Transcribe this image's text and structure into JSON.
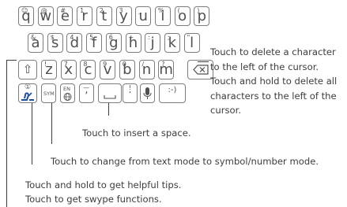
{
  "keyboard": {
    "row1": [
      {
        "main": "q",
        "alt": "☺"
      },
      {
        "main": "w",
        "alt": "@"
      },
      {
        "main": "e",
        "alt": "#"
      },
      {
        "main": "r",
        "alt": "1"
      },
      {
        "main": "t",
        "alt": "2"
      },
      {
        "main": "y",
        "alt": "3"
      },
      {
        "main": "u",
        "alt": "_"
      },
      {
        "main": "i",
        "alt": "%"
      },
      {
        "main": "o",
        "alt": "("
      },
      {
        "main": "p",
        "alt": ")"
      }
    ],
    "row2": [
      {
        "main": "a",
        "alt": "&"
      },
      {
        "main": "s",
        "alt": "$"
      },
      {
        "main": "d",
        "alt": "4"
      },
      {
        "main": "f",
        "alt": "5"
      },
      {
        "main": "g",
        "alt": "6"
      },
      {
        "main": "h",
        "alt": "+"
      },
      {
        "main": "j",
        "alt": ":"
      },
      {
        "main": "k",
        "alt": ";"
      },
      {
        "main": "l",
        "alt": "\""
      }
    ],
    "row3": [
      {
        "main": "z",
        "alt": "!"
      },
      {
        "main": "x",
        "alt": "7"
      },
      {
        "main": "c",
        "alt": "8"
      },
      {
        "main": "v",
        "alt": "9"
      },
      {
        "main": "b",
        "alt": "0"
      },
      {
        "main": "n",
        "alt": "/"
      },
      {
        "main": "m",
        "alt": "?"
      }
    ],
    "sym_label": "SYM",
    "en_label": "EN",
    "comma": ",",
    "comma_alt": "—",
    "period": ".",
    "period_alt": "!",
    "smiley": ":-)",
    "shift_icon": "⇧",
    "swype_badge": "①"
  },
  "annotations": {
    "delete": [
      "Touch to delete a character",
      "to the left of the cursor.",
      "Touch and hold to delete all",
      "characters to the left of the",
      "cursor."
    ],
    "space": "Touch to insert a space.",
    "sym": "Touch to change from text mode to symbol/number mode.",
    "tips": "Touch and hold to get helpful tips.",
    "swype": "Touch to get swype functions."
  }
}
